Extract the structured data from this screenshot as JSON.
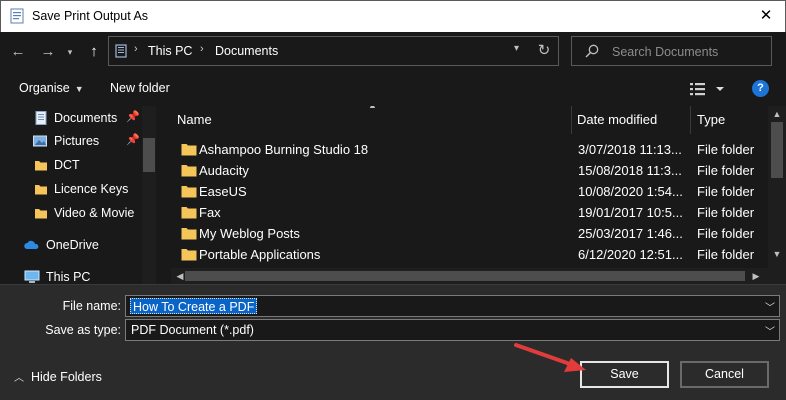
{
  "window": {
    "title": "Save Print Output As"
  },
  "address": {
    "crumbs": [
      "This PC",
      "Documents"
    ]
  },
  "search": {
    "placeholder": "Search Documents"
  },
  "toolbar": {
    "organise_label": "Organise",
    "new_folder_label": "New folder"
  },
  "navpane": {
    "items": [
      {
        "label": "Documents",
        "icon": "documents-icon",
        "pinned": true
      },
      {
        "label": "Pictures",
        "icon": "pictures-icon",
        "pinned": true
      },
      {
        "label": "DCT",
        "icon": "folder-icon",
        "pinned": false
      },
      {
        "label": "Licence Keys",
        "icon": "folder-icon",
        "pinned": false
      },
      {
        "label": "Video & Movie",
        "icon": "folder-icon",
        "pinned": false
      },
      {
        "label": "OneDrive",
        "icon": "onedrive-icon",
        "pinned": false
      },
      {
        "label": "This PC",
        "icon": "this-pc-icon",
        "pinned": false
      }
    ]
  },
  "filelist": {
    "columns": {
      "name": "Name",
      "date": "Date modified",
      "type": "Type"
    },
    "rows": [
      {
        "name": "Ashampoo Burning Studio 18",
        "date": "3/07/2018 11:13...",
        "type": "File folder"
      },
      {
        "name": "Audacity",
        "date": "15/08/2018 11:3...",
        "type": "File folder"
      },
      {
        "name": "EaseUS",
        "date": "10/08/2020 1:54...",
        "type": "File folder"
      },
      {
        "name": "Fax",
        "date": "19/01/2017 10:5...",
        "type": "File folder"
      },
      {
        "name": "My Weblog Posts",
        "date": "25/03/2017 1:46...",
        "type": "File folder"
      },
      {
        "name": "Portable Applications",
        "date": "6/12/2020 12:51...",
        "type": "File folder"
      }
    ]
  },
  "form": {
    "file_name_label": "File name:",
    "file_name_value": "How To Create a PDF",
    "save_type_label": "Save as type:",
    "save_type_value": "PDF Document (*.pdf)",
    "hide_folders_label": "Hide Folders",
    "save_label": "Save",
    "cancel_label": "Cancel"
  },
  "colors": {
    "background": "#191919",
    "form_background": "#2b2b2b",
    "selection": "#0a64c8",
    "annotation_arrow": "#e03c3c",
    "help_blue": "#1b74d6",
    "folder": "#f5c55a"
  }
}
